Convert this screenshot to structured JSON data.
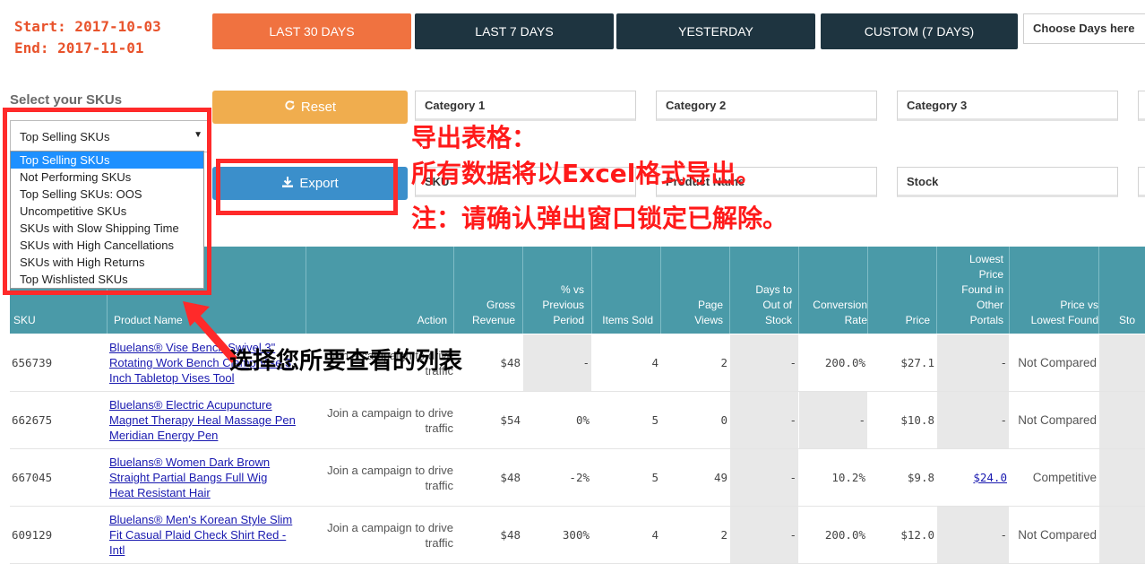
{
  "date_range": {
    "start": "Start: 2017-10-03",
    "end": "End: 2017-11-01"
  },
  "range_buttons": [
    {
      "label": "LAST 30 DAYS"
    },
    {
      "label": "LAST 7 DAYS"
    },
    {
      "label": "YESTERDAY"
    },
    {
      "label": "CUSTOM (7 DAYS)"
    }
  ],
  "choose_days_placeholder": "Choose Days here",
  "select_label": "Select your SKUs",
  "reset_label": "Reset",
  "export_label": "Export",
  "filters": {
    "category1": "Category 1",
    "category2": "Category 2",
    "category3": "Category 3",
    "sku": "SKU",
    "product_name": "Product Name",
    "stock": "Stock"
  },
  "sku_select": {
    "value": "Top Selling SKUs",
    "options": [
      "Top Selling SKUs",
      "Not Performing SKUs",
      "Top Selling SKUs: OOS",
      "Uncompetitive SKUs",
      "SKUs with Slow Shipping Time",
      "SKUs with High Cancellations",
      "SKUs with High Returns",
      "Top Wishlisted SKUs"
    ]
  },
  "annotations": {
    "export_title": "导出表格：",
    "export_line1": "所有数据将以Excel格式导出。",
    "export_line2": "注：请确认弹出窗口锁定已解除。",
    "select_list": "选择您所要查看的列表"
  },
  "table": {
    "headers": {
      "sku": "SKU",
      "product_name": "Product Name",
      "action": "Action",
      "gross_revenue": [
        "Gross",
        "Revenue"
      ],
      "vs_prev": [
        "% vs",
        "Previous",
        "Period"
      ],
      "items_sold": "Items Sold",
      "page_views": [
        "Page",
        "Views"
      ],
      "days_oos": [
        "Days to",
        "Out of",
        "Stock"
      ],
      "conversion": [
        "Conversion",
        "Rate"
      ],
      "price": "Price",
      "lowest_price": [
        "Lowest",
        "Price",
        "Found in",
        "Other",
        "Portals"
      ],
      "price_vs": [
        "Price vs",
        "Lowest Found"
      ],
      "stock": "Sto"
    },
    "rows": [
      {
        "sku": "656739",
        "product": [
          "Bluelans® Vise Bench Swivel 3\"",
          "Rotating Work Bench Clamp Vise 3",
          "Inch Tabletop Vises Tool"
        ],
        "action": [
          "Join a campaign to drive",
          "traffic"
        ],
        "gross_revenue": "$48",
        "vs_prev": "-",
        "items_sold": "4",
        "page_views": "2",
        "days_oos": "-",
        "conversion": "200.0%",
        "price": "$27.1",
        "lowest_price": "-",
        "price_vs": "Not Compared"
      },
      {
        "sku": "662675",
        "product": [
          "Bluelans® Electric Acupuncture",
          "Magnet Therapy Heal Massage Pen",
          "Meridian Energy Pen"
        ],
        "action": [
          "Join a campaign to drive",
          "traffic"
        ],
        "gross_revenue": "$54",
        "vs_prev": "0%",
        "items_sold": "5",
        "page_views": "0",
        "days_oos": "-",
        "conversion": "-",
        "price": "$10.8",
        "lowest_price": "-",
        "price_vs": "Not Compared"
      },
      {
        "sku": "667045",
        "product": [
          "Bluelans® Women Dark Brown",
          "Straight Partial Bangs Full Wig",
          "Heat Resistant Hair"
        ],
        "action": [
          "Join a campaign to drive",
          "traffic"
        ],
        "gross_revenue": "$48",
        "vs_prev": "-2%",
        "items_sold": "5",
        "page_views": "49",
        "days_oos": "-",
        "conversion": "10.2%",
        "price": "$9.8",
        "lowest_price": "$24.0",
        "price_vs": "Competitive"
      },
      {
        "sku": "609129",
        "product": [
          "Bluelans® Men's Korean Style Slim",
          "Fit Casual Plaid Check Shirt Red -",
          "Intl"
        ],
        "action": [
          "Join a campaign to drive",
          "traffic"
        ],
        "gross_revenue": "$48",
        "vs_prev": "300%",
        "items_sold": "4",
        "page_views": "2",
        "days_oos": "-",
        "conversion": "200.0%",
        "price": "$12.0",
        "lowest_price": "-",
        "price_vs": "Not Compared"
      }
    ]
  },
  "colors": {
    "accent_orange": "#f07240",
    "dark_button": "#1e3440",
    "reset_button": "#f0ad4e",
    "export_button": "#3b8fcb",
    "table_header": "#4a9aa8",
    "annotation_red": "#ff2a2a"
  }
}
